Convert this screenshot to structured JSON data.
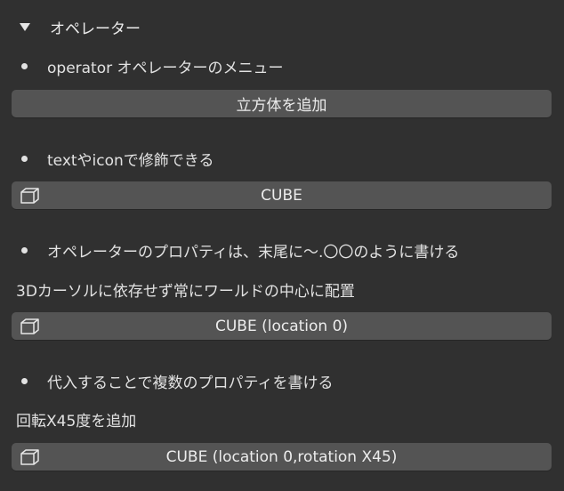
{
  "panel": {
    "header_title": "オペレーター",
    "sections": {
      "s1": {
        "bullet": "operator オペレーターのメニュー",
        "button": "立方体を追加"
      },
      "s2": {
        "bullet": "textやiconで修飾できる",
        "button": "CUBE",
        "icon": "cube-icon"
      },
      "s3": {
        "bullet": "オペレーターのプロパティは、末尾に～.〇〇のように書ける",
        "label": "3Dカーソルに依存せず常にワールドの中心に配置",
        "button": "CUBE (location 0)",
        "icon": "cube-icon"
      },
      "s4": {
        "bullet": "代入することで複数のプロパティを書ける",
        "label": "回転X45度を追加",
        "button": "CUBE (location 0,rotation X45)",
        "icon": "cube-icon"
      }
    }
  },
  "colors": {
    "background": "#303030",
    "button": "#545454",
    "text": "#e6e6e6"
  }
}
